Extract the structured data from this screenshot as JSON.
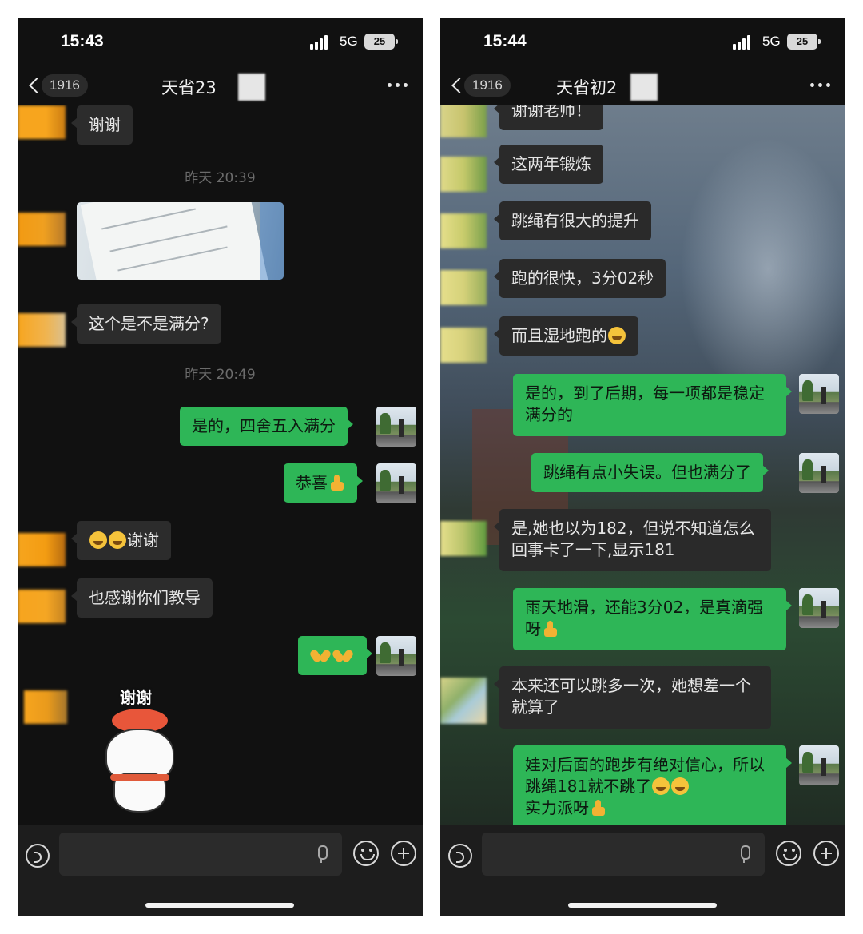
{
  "left_phone": {
    "status": {
      "time": "15:43",
      "network": "5G",
      "battery": "25"
    },
    "nav": {
      "badge": "1916",
      "title": "天省23"
    },
    "messages": {
      "m1": "谢谢",
      "ts1": "昨天 20:39",
      "m2": "这个是不是满分?",
      "ts2": "昨天 20:49",
      "m3": "是的，四舍五入满分",
      "m4": "恭喜",
      "m5": "谢谢",
      "m6": "也感谢你们教导"
    },
    "sticker_caption": "谢谢"
  },
  "right_phone": {
    "status": {
      "time": "15:44",
      "network": "5G",
      "battery": "25"
    },
    "nav": {
      "badge": "1916",
      "title": "天省初2"
    },
    "messages": {
      "m1": "谢谢老师！",
      "m2": "这两年锻炼",
      "m3": "跳绳有很大的提升",
      "m4": "跑的很快，3分02秒",
      "m5": "而且湿地跑的",
      "m6": "是的，到了后期，每一项都是稳定满分的",
      "m7": "跳绳有点小失误。但也满分了",
      "m8": "是,她也以为182，但说不知道怎么回事卡了一下,显示181",
      "m9": "雨天地滑，还能3分02，是真滴强呀",
      "m10": "本来还可以跳多一次，她想差一个就算了",
      "m11a": "娃对后面的跑步有绝对信心，所以跳绳181就不跳了",
      "m11b": "实力派呀"
    }
  },
  "icons": [
    "back-icon",
    "more-icon",
    "signal-icon",
    "battery-icon",
    "voice-icon",
    "mic-icon",
    "face-icon",
    "plus-icon",
    "thumbs-up-icon",
    "laugh-emoji-icon",
    "clap-icon"
  ],
  "colors": {
    "outgoing_bubble": "#2eb657",
    "incoming_bubble": "#2c2c2c",
    "background": "#111111"
  }
}
